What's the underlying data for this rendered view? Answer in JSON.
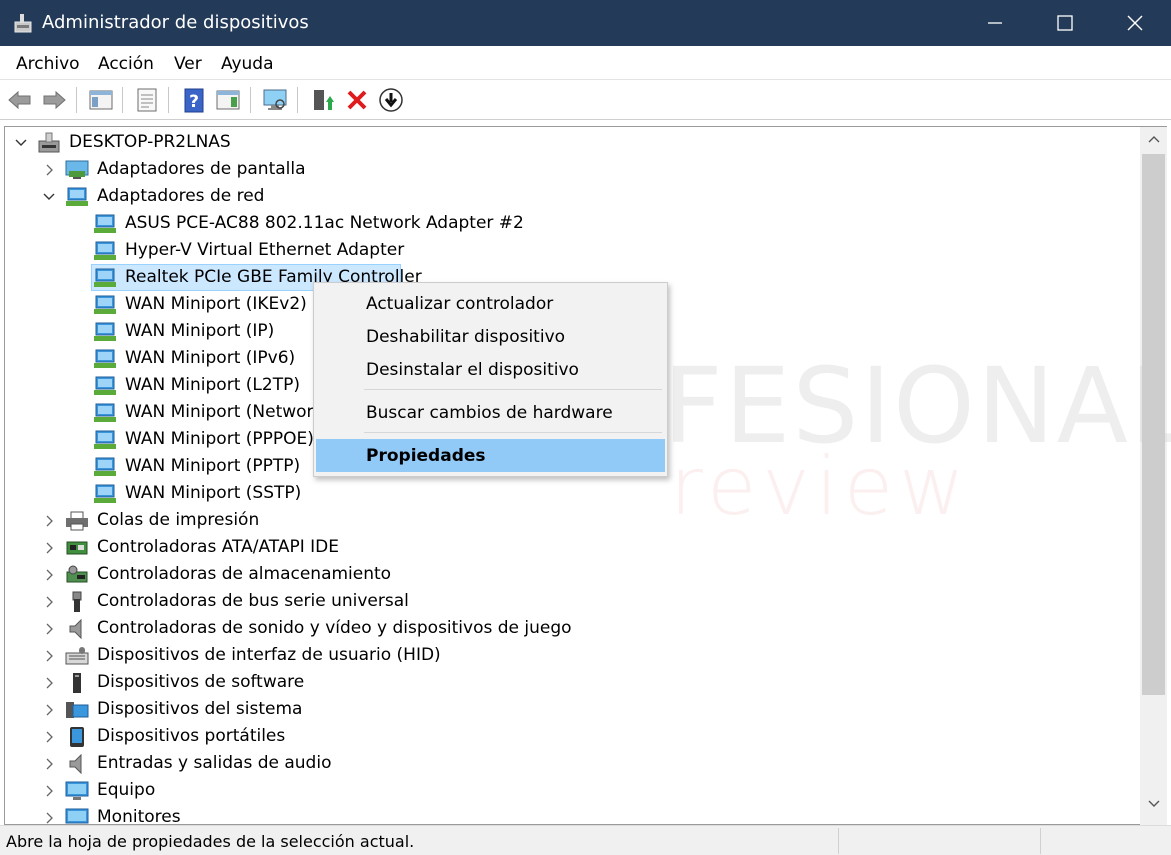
{
  "window": {
    "title": "Administrador de dispositivos",
    "title_bar_color": "#233a59"
  },
  "menu": [
    "Archivo",
    "Acción",
    "Ver",
    "Ayuda"
  ],
  "toolbar_icons": [
    "back-arrow-icon",
    "forward-arrow-icon",
    "show-hide-console-tree-icon",
    "properties-icon",
    "help-icon",
    "action-pane-icon",
    "scan-hardware-icon",
    "update-driver-icon",
    "uninstall-icon",
    "disable-device-icon"
  ],
  "tree": {
    "root": "DESKTOP-PR2LNAS",
    "items": [
      {
        "label": "Adaptadores de pantalla",
        "icon": "display-adapter-icon",
        "expanded": false
      },
      {
        "label": "Adaptadores de red",
        "icon": "network-adapter-icon",
        "expanded": true,
        "children": [
          "ASUS PCE-AC88 802.11ac Network Adapter #2",
          "Hyper-V Virtual Ethernet Adapter",
          "Realtek PCIe GBE Family Controller",
          "WAN Miniport (IKEv2)",
          "WAN Miniport (IP)",
          "WAN Miniport (IPv6)",
          "WAN Miniport (L2TP)",
          "WAN Miniport (Network Monitor)",
          "WAN Miniport (PPPOE)",
          "WAN Miniport (PPTP)",
          "WAN Miniport (SSTP)"
        ]
      },
      {
        "label": "Colas de impresión",
        "icon": "printer-icon",
        "expanded": false
      },
      {
        "label": "Controladoras ATA/ATAPI IDE",
        "icon": "ide-controller-icon",
        "expanded": false
      },
      {
        "label": "Controladoras de almacenamiento",
        "icon": "storage-controller-icon",
        "expanded": false
      },
      {
        "label": "Controladoras de bus serie universal",
        "icon": "usb-icon",
        "expanded": false
      },
      {
        "label": "Controladoras de sonido y vídeo y dispositivos de juego",
        "icon": "speaker-icon",
        "expanded": false
      },
      {
        "label": "Dispositivos de interfaz de usuario (HID)",
        "icon": "hid-icon",
        "expanded": false
      },
      {
        "label": "Dispositivos de software",
        "icon": "software-device-icon",
        "expanded": false
      },
      {
        "label": "Dispositivos del sistema",
        "icon": "system-device-icon",
        "expanded": false
      },
      {
        "label": "Dispositivos portátiles",
        "icon": "portable-device-icon",
        "expanded": false
      },
      {
        "label": "Entradas y salidas de audio",
        "icon": "audio-io-icon",
        "expanded": false
      },
      {
        "label": "Equipo",
        "icon": "computer-icon",
        "expanded": false
      },
      {
        "label": "Monitores",
        "icon": "monitor-icon",
        "expanded": false
      }
    ],
    "selected": "Realtek PCIe GBE Family Controller"
  },
  "context_menu": {
    "items": [
      "Actualizar controlador",
      "Deshabilitar dispositivo",
      "Desinstalar el dispositivo",
      "Buscar cambios de hardware",
      "Propiedades"
    ],
    "active": "Propiedades"
  },
  "watermark": {
    "line1": "PROFESIONAL",
    "line2": "review"
  },
  "status": "Abre la hoja de propiedades de la selección actual.",
  "colors": {
    "selection": "#cce8ff",
    "menu_highlight": "#91c9f7",
    "network_icon": "#2f8fd8"
  }
}
